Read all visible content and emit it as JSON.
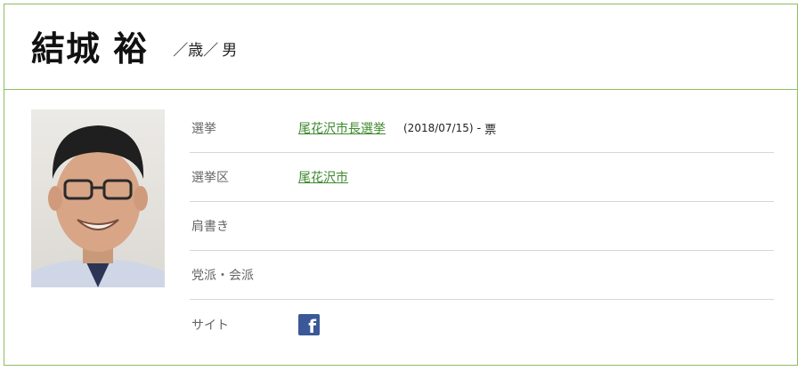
{
  "profile": {
    "name": "結城 裕",
    "age_text": "／歳／",
    "gender": "男"
  },
  "rows": {
    "election": {
      "label": "選挙",
      "link": "尾花沢市長選挙",
      "date": "(2018/07/15)",
      "sep": "-",
      "votes": "票"
    },
    "district": {
      "label": "選挙区",
      "link": "尾花沢市"
    },
    "title": {
      "label": "肩書き",
      "value": ""
    },
    "party": {
      "label": "党派・会派",
      "value": ""
    },
    "site": {
      "label": "サイト",
      "icon": "facebook-icon"
    }
  },
  "colors": {
    "accent": "#8cbf5f",
    "link": "#3f8a2e",
    "facebook": "#3b5998"
  }
}
